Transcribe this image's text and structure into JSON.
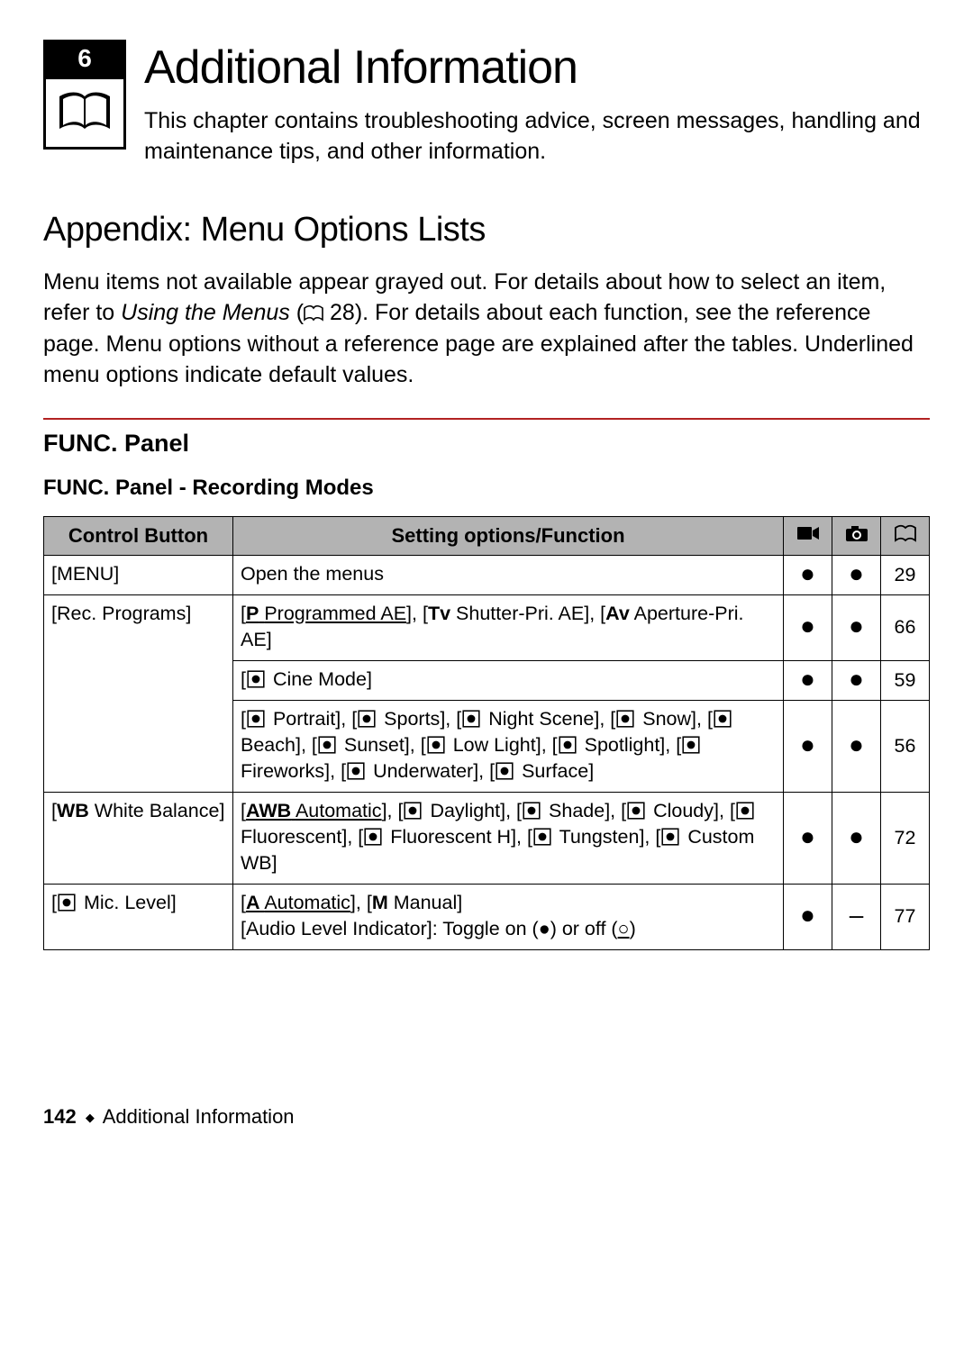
{
  "chapter": {
    "number": "6",
    "title": "Additional Information",
    "intro": "This chapter contains troubleshooting advice, screen messages, handling and maintenance tips, and other information."
  },
  "appendix": {
    "title": "Appendix: Menu Options Lists",
    "body_pre": "Menu items not available appear grayed out. For details about how to select an item, refer to ",
    "body_italic": "Using the Menus",
    "body_ref": "28",
    "body_post": "). For details about each function, see the reference page. Menu options without a reference page are explained after the tables. Underlined menu options indicate default values."
  },
  "panel": {
    "title": "FUNC. Panel",
    "subtitle": "FUNC. Panel - Recording Modes",
    "headers": {
      "control": "Control Button",
      "options": "Setting options/Function"
    },
    "rows": [
      {
        "control": "[MENU]",
        "options_html": "Open the menus",
        "video": "●",
        "photo": "●",
        "ref": "29"
      },
      {
        "control": "[Rec. Programs]",
        "options_items": [
          {
            "abbr": "P",
            "label": "Programmed AE",
            "underline": true,
            "sep": ", "
          },
          {
            "abbr": "Tv",
            "label": "Shutter-Pri. AE",
            "sep": ", "
          },
          {
            "abbr": "Av",
            "label": "Aperture-Pri. AE",
            "sep": ""
          }
        ],
        "video": "●",
        "photo": "●",
        "ref": "66"
      },
      {
        "control": "",
        "options_items": [
          {
            "icon": "cine-icon",
            "label": "Cine Mode",
            "sep": ""
          }
        ],
        "video": "●",
        "photo": "●",
        "ref": "59"
      },
      {
        "control": "",
        "options_items": [
          {
            "icon": "portrait-icon",
            "label": "Portrait",
            "sep": ", "
          },
          {
            "icon": "sports-icon",
            "label": "Sports",
            "sep": ", "
          },
          {
            "icon": "night-icon",
            "label": "Night Scene",
            "sep": ", "
          },
          {
            "icon": "snow-icon",
            "label": "Snow",
            "sep": ", "
          },
          {
            "icon": "beach-icon",
            "label": "Beach",
            "sep": ", "
          },
          {
            "icon": "sunset-icon",
            "label": "Sunset",
            "sep": ", "
          },
          {
            "icon": "lowlight-icon",
            "label": "Low Light",
            "sep": ", "
          },
          {
            "icon": "spotlight-icon",
            "label": "Spotlight",
            "sep": ", "
          },
          {
            "icon": "fireworks-icon",
            "label": "Fireworks",
            "sep": ", "
          },
          {
            "icon": "underwater-icon",
            "label": "Underwater",
            "sep": ", "
          },
          {
            "icon": "surface-icon",
            "label": "Surface",
            "sep": ""
          }
        ],
        "video": "●",
        "photo": "●",
        "ref": "56"
      },
      {
        "control_items": [
          {
            "abbr": "WB",
            "label": "White Balance"
          }
        ],
        "options_items": [
          {
            "abbr": "AWB",
            "label": "Automatic",
            "underline": true,
            "sep": ", "
          },
          {
            "icon": "daylight-icon",
            "label": "Daylight",
            "sep": ", "
          },
          {
            "icon": "shade-icon",
            "label": "Shade",
            "sep": ", "
          },
          {
            "icon": "cloudy-icon",
            "label": "Cloudy",
            "sep": ", "
          },
          {
            "icon": "fluorescent-icon",
            "label": "Fluorescent",
            "sep": ", "
          },
          {
            "icon": "fluorescent-h-icon",
            "label": "Fluorescent H",
            "sep": ", "
          },
          {
            "icon": "tungsten-icon",
            "label": "Tungsten",
            "sep": ", "
          },
          {
            "icon": "custom-wb-icon",
            "label": "Custom WB",
            "sep": ""
          }
        ],
        "video": "●",
        "photo": "●",
        "ref": "72"
      },
      {
        "control_items": [
          {
            "icon": "mic-icon",
            "label": "Mic. Level"
          }
        ],
        "options_items_mic": {
          "auto": {
            "abbr": "A",
            "label": "Automatic",
            "underline": true
          },
          "manual": {
            "abbr": "M",
            "label": "Manual"
          },
          "line2_pre": "[Audio Level Indicator]: Toggle on (",
          "line2_on": "●",
          "line2_mid": ") or off (",
          "line2_off": "○",
          "line2_post": ")"
        },
        "video": "●",
        "photo": "–",
        "ref": "77"
      }
    ]
  },
  "footer": {
    "page": "142",
    "section": "Additional Information"
  }
}
